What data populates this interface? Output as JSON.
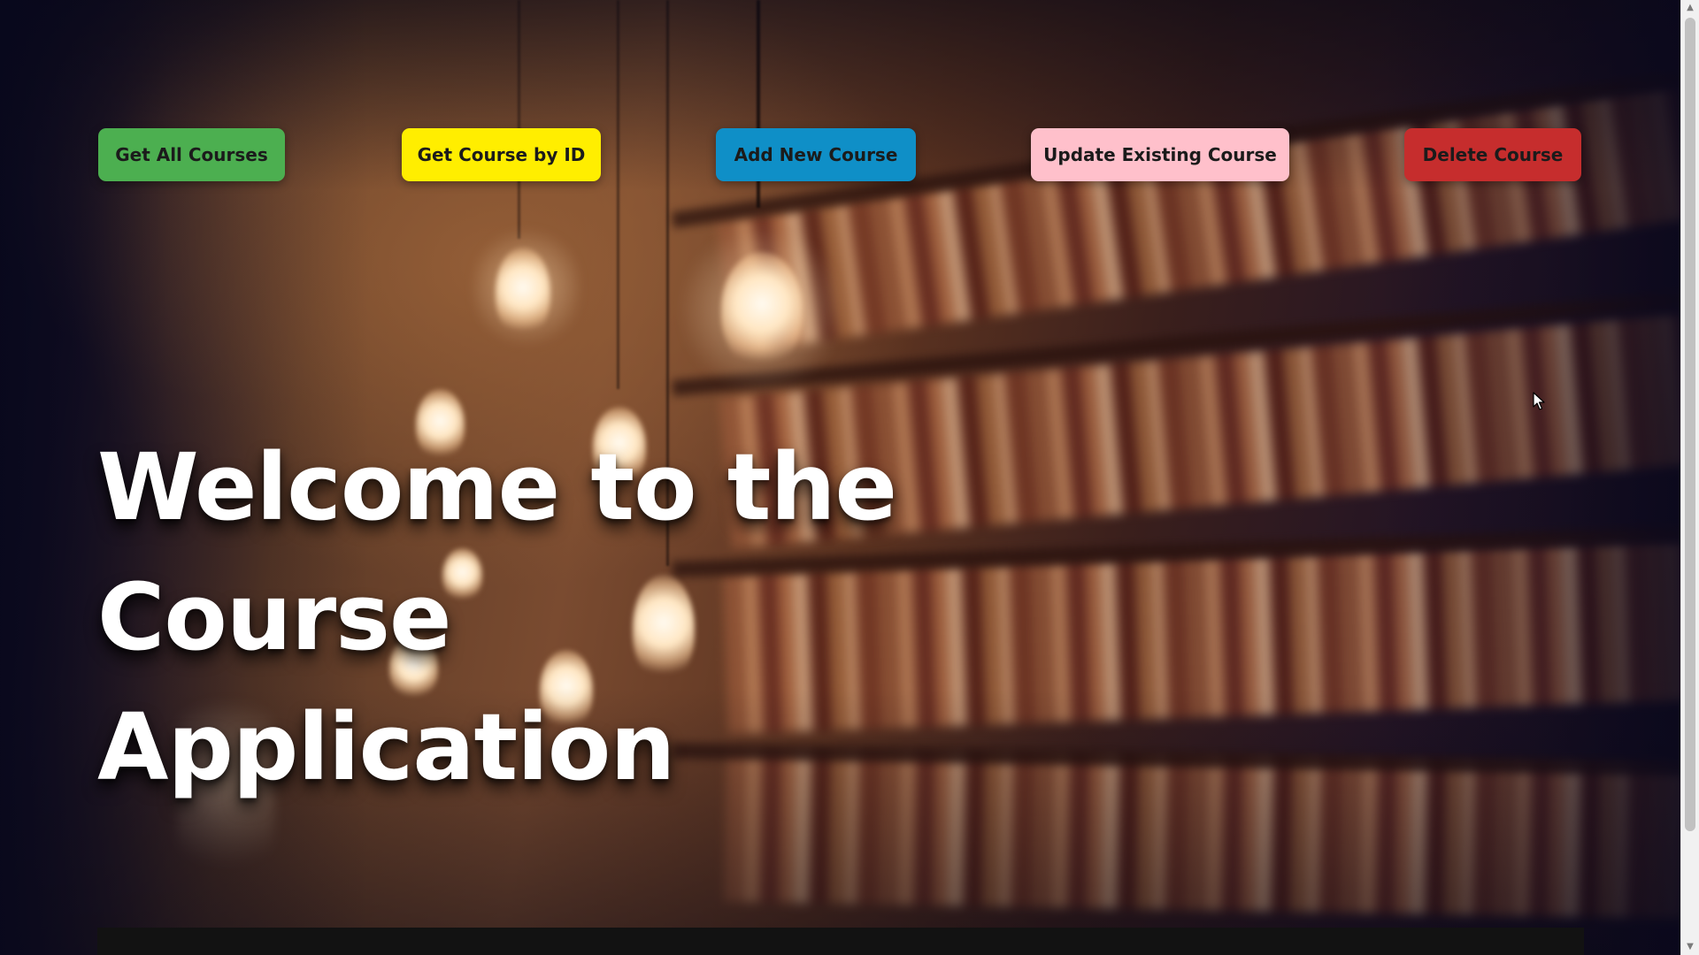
{
  "nav": {
    "buttons": [
      {
        "label": "Get All Courses",
        "color": "#4caf50"
      },
      {
        "label": "Get Course by ID",
        "color": "#ffee00"
      },
      {
        "label": "Add New Course",
        "color": "#0f8fc7"
      },
      {
        "label": "Update Existing Course",
        "color": "#ffc0cb"
      },
      {
        "label": "Delete Course",
        "color": "#c62d2d"
      }
    ]
  },
  "hero": {
    "line1": "Welcome to the Course",
    "line2": "Application"
  },
  "scrollbar": {
    "up_icon": "triangle-up-icon",
    "down_icon": "triangle-down-icon"
  },
  "cursor": {
    "icon": "mouse-pointer-icon"
  }
}
